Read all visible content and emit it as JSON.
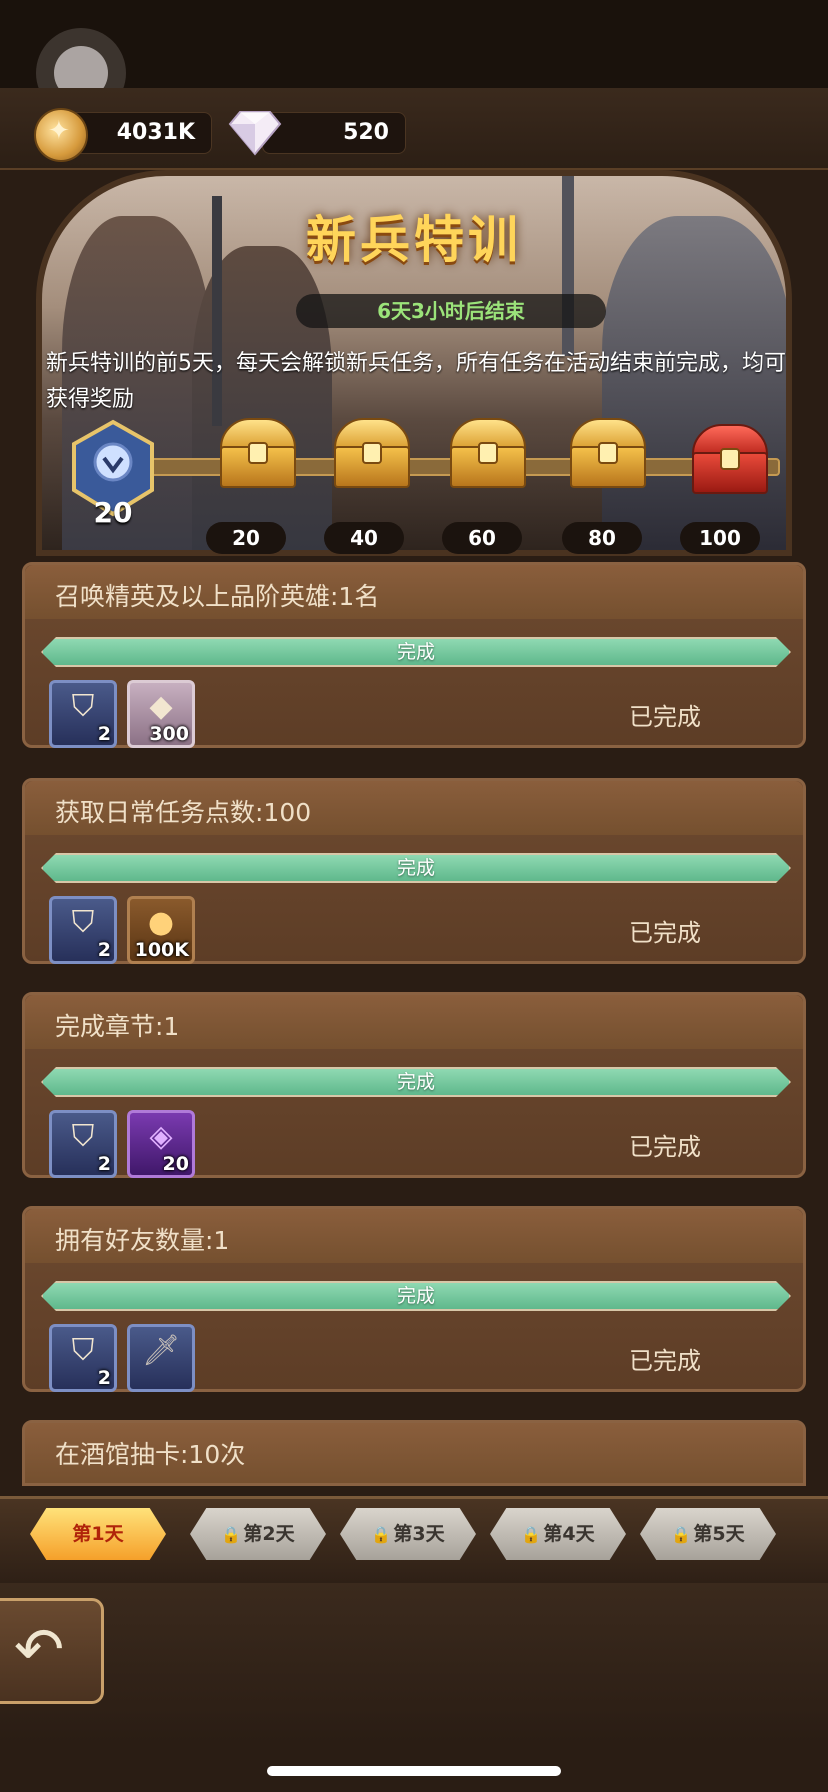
{
  "currency": {
    "gold": "4031K",
    "diamonds": "520"
  },
  "banner": {
    "title": "新兵特训",
    "timer": "6天3小时后结束",
    "description": "新兵特训的前5天，每天会解锁新兵任务，所有任务在活动结束前完成，均可获得奖励"
  },
  "milestones": {
    "current_points": "20",
    "thresholds": [
      "20",
      "40",
      "60",
      "80",
      "100"
    ]
  },
  "tasks": [
    {
      "title": "召唤精英及以上品阶英雄:1名",
      "progress_label": "完成",
      "progress": 1.0,
      "rewards": [
        {
          "icon": "badge-icon",
          "qty": "2"
        },
        {
          "icon": "diamond-icon",
          "qty": "300"
        }
      ],
      "status": "已完成"
    },
    {
      "title": "获取日常任务点数:100",
      "progress_label": "完成",
      "progress": 1.0,
      "rewards": [
        {
          "icon": "badge-icon",
          "qty": "2"
        },
        {
          "icon": "gold-coin-icon",
          "qty": "100K"
        }
      ],
      "status": "已完成"
    },
    {
      "title": "完成章节:1",
      "progress_label": "完成",
      "progress": 1.0,
      "rewards": [
        {
          "icon": "badge-icon",
          "qty": "2"
        },
        {
          "icon": "hero-shard-icon",
          "qty": "20"
        }
      ],
      "status": "已完成"
    },
    {
      "title": "拥有好友数量:1",
      "progress_label": "完成",
      "progress": 1.0,
      "rewards": [
        {
          "icon": "badge-icon",
          "qty": "2"
        },
        {
          "icon": "sword-icon",
          "qty": ""
        }
      ],
      "status": "已完成"
    },
    {
      "title": "在酒馆抽卡:10次"
    }
  ],
  "day_tabs": [
    {
      "label": "第1天",
      "active": true,
      "locked": false
    },
    {
      "label": "第2天",
      "active": false,
      "locked": true
    },
    {
      "label": "第3天",
      "active": false,
      "locked": true
    },
    {
      "label": "第4天",
      "active": false,
      "locked": true
    },
    {
      "label": "第5天",
      "active": false,
      "locked": true
    }
  ],
  "colors": {
    "progress_fill": "#6fc79a",
    "active_tab": "#f5a02a",
    "title_gold": "#ffd55a",
    "timer_green": "#9be37a"
  }
}
